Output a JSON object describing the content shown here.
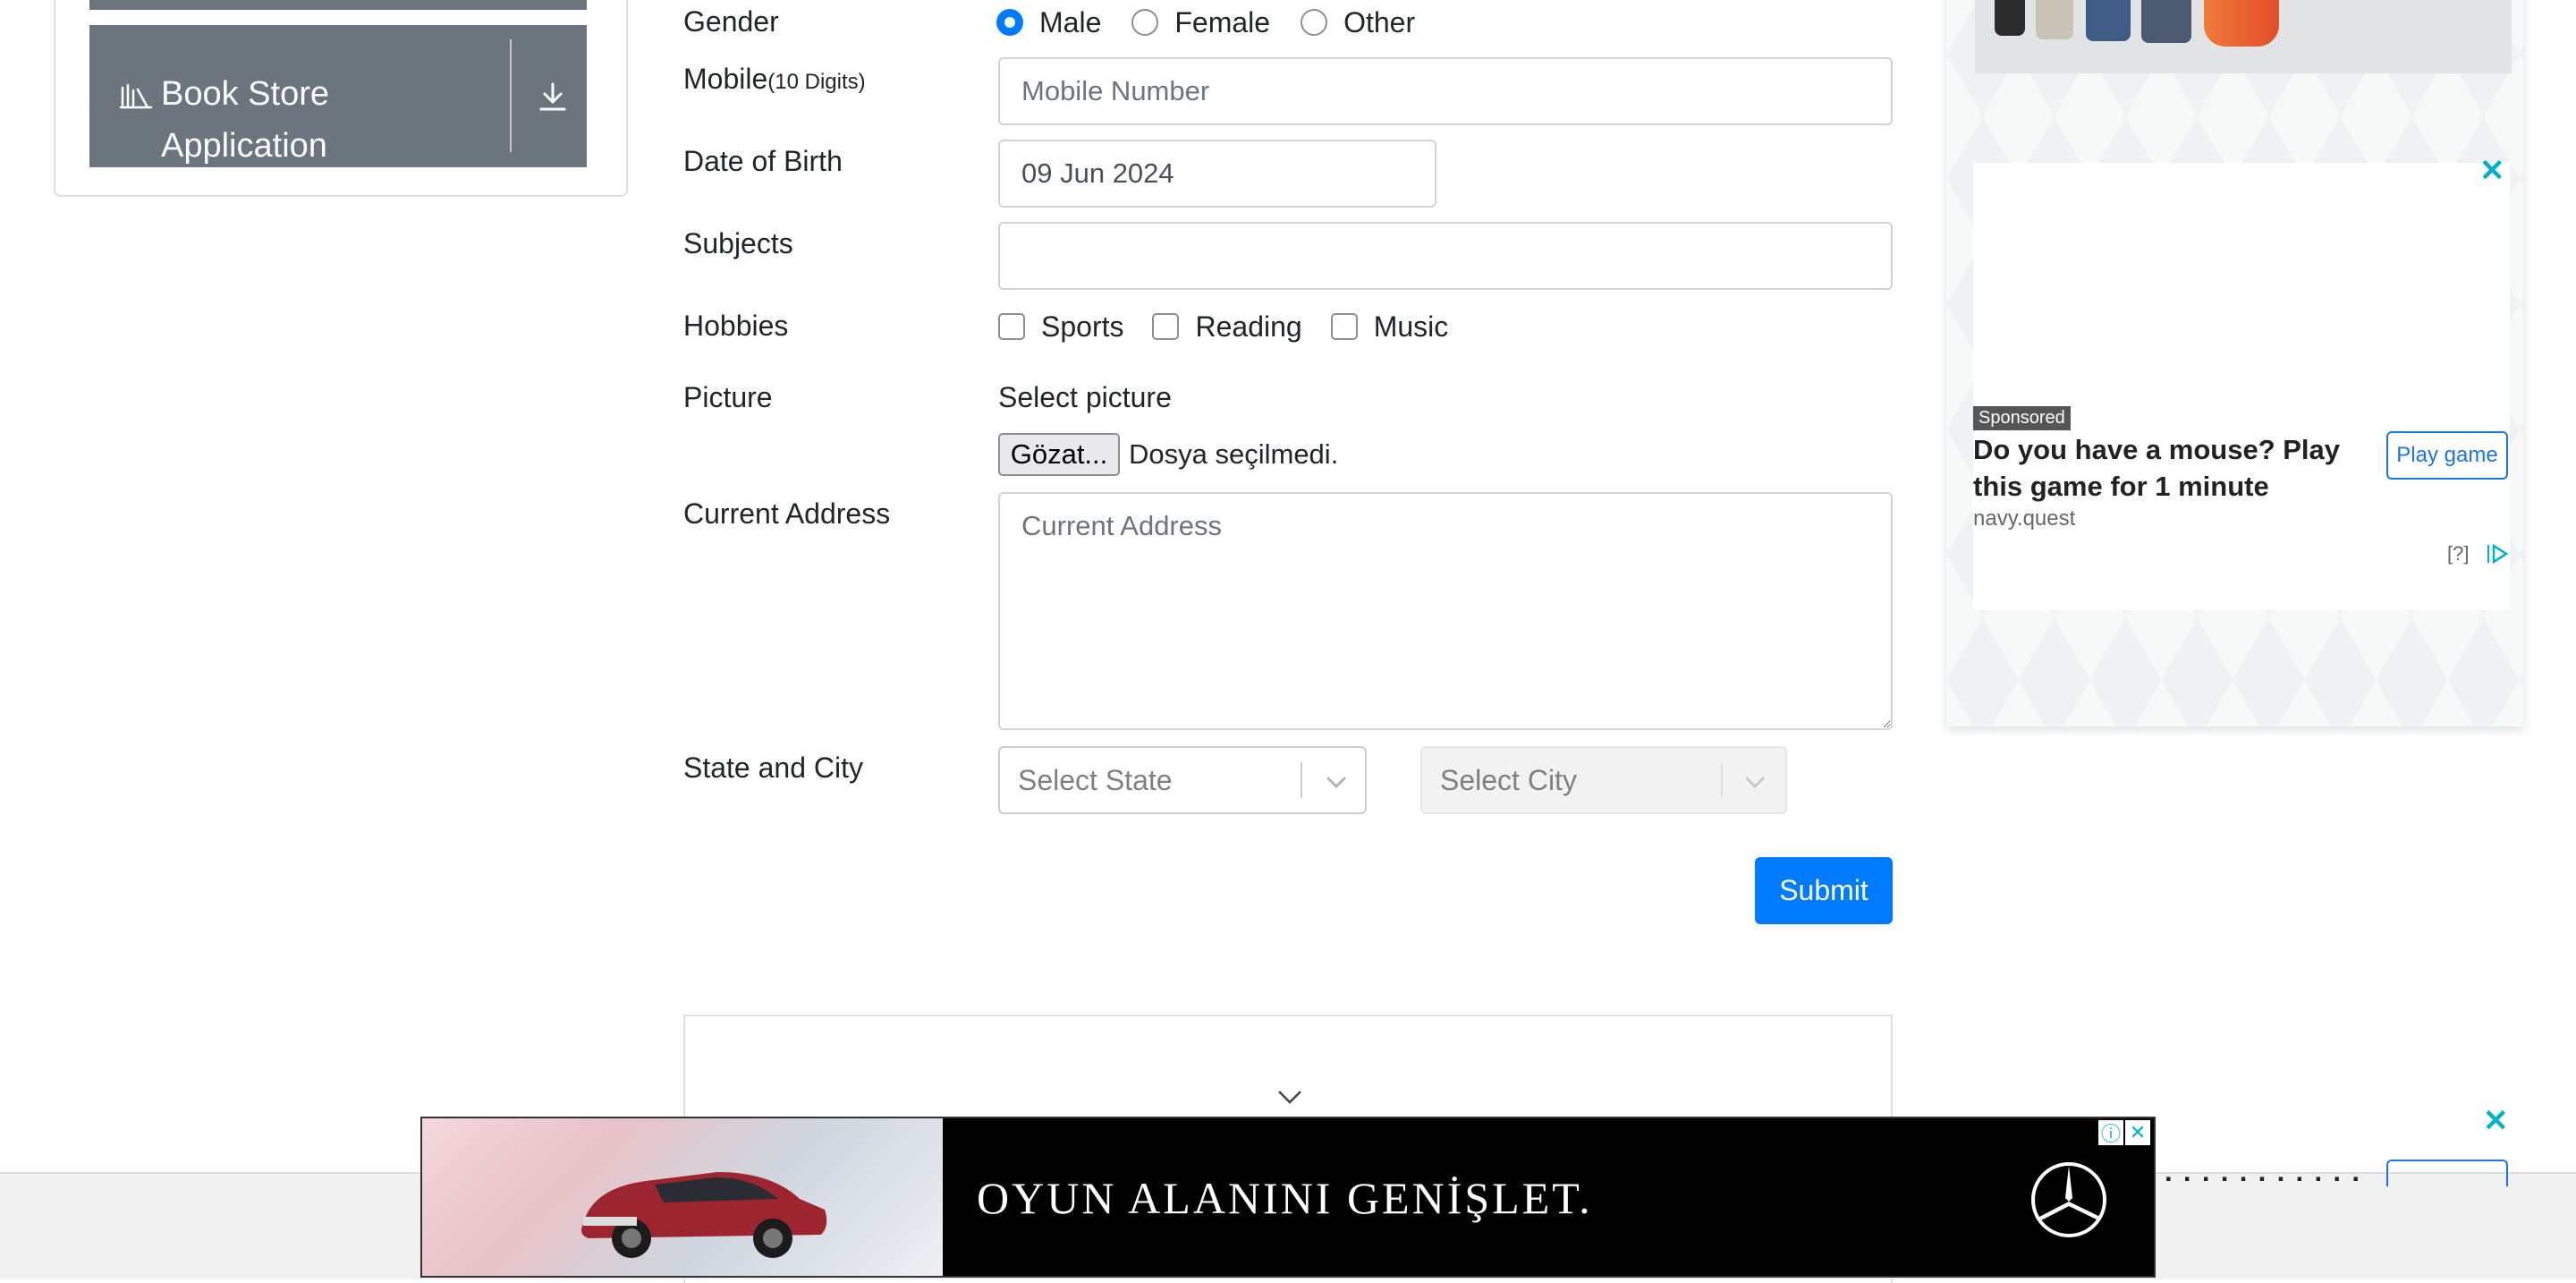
{
  "sidebar": {
    "item": {
      "label": "Book Store Application",
      "icon": "book-store-icon",
      "action_icon": "download-icon"
    }
  },
  "form": {
    "gender": {
      "label": "Gender",
      "options": [
        "Male",
        "Female",
        "Other"
      ],
      "selected": "Male"
    },
    "mobile": {
      "label": "Mobile",
      "hint": "(10 Digits)",
      "placeholder": "Mobile Number",
      "value": ""
    },
    "dob": {
      "label": "Date of Birth",
      "value": "09 Jun 2024"
    },
    "subjects": {
      "label": "Subjects",
      "value": ""
    },
    "hobbies": {
      "label": "Hobbies",
      "options": [
        "Sports",
        "Reading",
        "Music"
      ],
      "checked": []
    },
    "picture": {
      "label": "Picture",
      "prompt": "Select picture",
      "button": "Gözat...",
      "status": "Dosya seçilmedi."
    },
    "address": {
      "label": "Current Address",
      "placeholder": "Current Address",
      "value": ""
    },
    "state_city": {
      "label": "State and City",
      "state_placeholder": "Select State",
      "city_placeholder": "Select City",
      "city_disabled": true
    },
    "submit_label": "Submit"
  },
  "ads": {
    "side": {
      "close": "✕",
      "sponsored": "Sponsored",
      "title": "Do you have a mouse? Play this game for 1 minute",
      "domain": "navy.quest",
      "button": "Play game",
      "help": "[?]"
    },
    "banner": {
      "text": "OYUN ALANINI GENİŞLET.",
      "info_icon": "ⓘ",
      "close_icon": "✕"
    },
    "peek_close": "✕"
  },
  "colors": {
    "primary": "#007bff",
    "sidebar": "#6c757d",
    "ad_accent": "#00aecd"
  }
}
